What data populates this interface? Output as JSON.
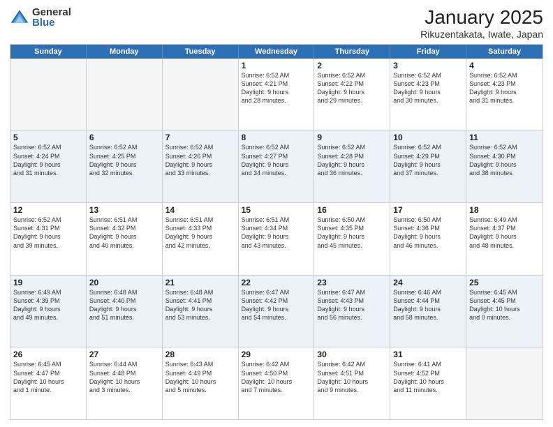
{
  "header": {
    "logo_general": "General",
    "logo_blue": "Blue",
    "title": "January 2025",
    "location": "Rikuzentakata, Iwate, Japan"
  },
  "calendar": {
    "days_of_week": [
      "Sunday",
      "Monday",
      "Tuesday",
      "Wednesday",
      "Thursday",
      "Friday",
      "Saturday"
    ],
    "rows": [
      {
        "alt": false,
        "cells": [
          {
            "empty": true,
            "day": "",
            "detail": ""
          },
          {
            "empty": true,
            "day": "",
            "detail": ""
          },
          {
            "empty": true,
            "day": "",
            "detail": ""
          },
          {
            "empty": false,
            "day": "1",
            "detail": "Sunrise: 6:52 AM\nSunset: 4:21 PM\nDaylight: 9 hours\nand 28 minutes."
          },
          {
            "empty": false,
            "day": "2",
            "detail": "Sunrise: 6:52 AM\nSunset: 4:22 PM\nDaylight: 9 hours\nand 29 minutes."
          },
          {
            "empty": false,
            "day": "3",
            "detail": "Sunrise: 6:52 AM\nSunset: 4:23 PM\nDaylight: 9 hours\nand 30 minutes."
          },
          {
            "empty": false,
            "day": "4",
            "detail": "Sunrise: 6:52 AM\nSunset: 4:23 PM\nDaylight: 9 hours\nand 31 minutes."
          }
        ]
      },
      {
        "alt": true,
        "cells": [
          {
            "empty": false,
            "day": "5",
            "detail": "Sunrise: 6:52 AM\nSunset: 4:24 PM\nDaylight: 9 hours\nand 31 minutes."
          },
          {
            "empty": false,
            "day": "6",
            "detail": "Sunrise: 6:52 AM\nSunset: 4:25 PM\nDaylight: 9 hours\nand 32 minutes."
          },
          {
            "empty": false,
            "day": "7",
            "detail": "Sunrise: 6:52 AM\nSunset: 4:26 PM\nDaylight: 9 hours\nand 33 minutes."
          },
          {
            "empty": false,
            "day": "8",
            "detail": "Sunrise: 6:52 AM\nSunset: 4:27 PM\nDaylight: 9 hours\nand 34 minutes."
          },
          {
            "empty": false,
            "day": "9",
            "detail": "Sunrise: 6:52 AM\nSunset: 4:28 PM\nDaylight: 9 hours\nand 36 minutes."
          },
          {
            "empty": false,
            "day": "10",
            "detail": "Sunrise: 6:52 AM\nSunset: 4:29 PM\nDaylight: 9 hours\nand 37 minutes."
          },
          {
            "empty": false,
            "day": "11",
            "detail": "Sunrise: 6:52 AM\nSunset: 4:30 PM\nDaylight: 9 hours\nand 38 minutes."
          }
        ]
      },
      {
        "alt": false,
        "cells": [
          {
            "empty": false,
            "day": "12",
            "detail": "Sunrise: 6:52 AM\nSunset: 4:31 PM\nDaylight: 9 hours\nand 39 minutes."
          },
          {
            "empty": false,
            "day": "13",
            "detail": "Sunrise: 6:51 AM\nSunset: 4:32 PM\nDaylight: 9 hours\nand 40 minutes."
          },
          {
            "empty": false,
            "day": "14",
            "detail": "Sunrise: 6:51 AM\nSunset: 4:33 PM\nDaylight: 9 hours\nand 42 minutes."
          },
          {
            "empty": false,
            "day": "15",
            "detail": "Sunrise: 6:51 AM\nSunset: 4:34 PM\nDaylight: 9 hours\nand 43 minutes."
          },
          {
            "empty": false,
            "day": "16",
            "detail": "Sunrise: 6:50 AM\nSunset: 4:35 PM\nDaylight: 9 hours\nand 45 minutes."
          },
          {
            "empty": false,
            "day": "17",
            "detail": "Sunrise: 6:50 AM\nSunset: 4:36 PM\nDaylight: 9 hours\nand 46 minutes."
          },
          {
            "empty": false,
            "day": "18",
            "detail": "Sunrise: 6:49 AM\nSunset: 4:37 PM\nDaylight: 9 hours\nand 48 minutes."
          }
        ]
      },
      {
        "alt": true,
        "cells": [
          {
            "empty": false,
            "day": "19",
            "detail": "Sunrise: 6:49 AM\nSunset: 4:39 PM\nDaylight: 9 hours\nand 49 minutes."
          },
          {
            "empty": false,
            "day": "20",
            "detail": "Sunrise: 6:48 AM\nSunset: 4:40 PM\nDaylight: 9 hours\nand 51 minutes."
          },
          {
            "empty": false,
            "day": "21",
            "detail": "Sunrise: 6:48 AM\nSunset: 4:41 PM\nDaylight: 9 hours\nand 53 minutes."
          },
          {
            "empty": false,
            "day": "22",
            "detail": "Sunrise: 6:47 AM\nSunset: 4:42 PM\nDaylight: 9 hours\nand 54 minutes."
          },
          {
            "empty": false,
            "day": "23",
            "detail": "Sunrise: 6:47 AM\nSunset: 4:43 PM\nDaylight: 9 hours\nand 56 minutes."
          },
          {
            "empty": false,
            "day": "24",
            "detail": "Sunrise: 6:46 AM\nSunset: 4:44 PM\nDaylight: 9 hours\nand 58 minutes."
          },
          {
            "empty": false,
            "day": "25",
            "detail": "Sunrise: 6:45 AM\nSunset: 4:45 PM\nDaylight: 10 hours\nand 0 minutes."
          }
        ]
      },
      {
        "alt": false,
        "cells": [
          {
            "empty": false,
            "day": "26",
            "detail": "Sunrise: 6:45 AM\nSunset: 4:47 PM\nDaylight: 10 hours\nand 1 minute."
          },
          {
            "empty": false,
            "day": "27",
            "detail": "Sunrise: 6:44 AM\nSunset: 4:48 PM\nDaylight: 10 hours\nand 3 minutes."
          },
          {
            "empty": false,
            "day": "28",
            "detail": "Sunrise: 6:43 AM\nSunset: 4:49 PM\nDaylight: 10 hours\nand 5 minutes."
          },
          {
            "empty": false,
            "day": "29",
            "detail": "Sunrise: 6:42 AM\nSunset: 4:50 PM\nDaylight: 10 hours\nand 7 minutes."
          },
          {
            "empty": false,
            "day": "30",
            "detail": "Sunrise: 6:42 AM\nSunset: 4:51 PM\nDaylight: 10 hours\nand 9 minutes."
          },
          {
            "empty": false,
            "day": "31",
            "detail": "Sunrise: 6:41 AM\nSunset: 4:52 PM\nDaylight: 10 hours\nand 11 minutes."
          },
          {
            "empty": true,
            "day": "",
            "detail": ""
          }
        ]
      }
    ]
  }
}
